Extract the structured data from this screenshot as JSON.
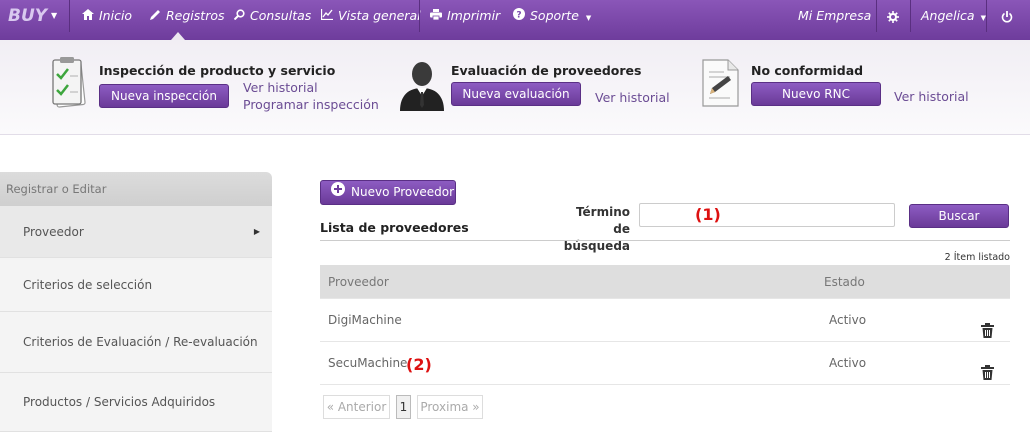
{
  "navbar": {
    "brand": "BUY",
    "items": [
      {
        "label": "Inicio"
      },
      {
        "label": "Registros"
      },
      {
        "label": "Consultas"
      },
      {
        "label": "Vista general"
      },
      {
        "label": "Imprimir"
      },
      {
        "label": "Soporte"
      }
    ],
    "company": "Mi Empresa",
    "user": "Angelica"
  },
  "modules": {
    "inspection": {
      "title": "Inspección de producto y servicio",
      "button": "Nueva inspección",
      "link_history": "Ver historial",
      "link_schedule": "Programar inspección"
    },
    "suppliers": {
      "title": "Evaluación de proveedores",
      "button": "Nueva evaluación",
      "link_history": "Ver historial"
    },
    "nonconformity": {
      "title": "No conformidad",
      "button": "Nuevo RNC",
      "link_history": "Ver historial"
    }
  },
  "sidebar": {
    "header": "Registrar o Editar",
    "items": [
      {
        "label": "Proveedor"
      },
      {
        "label": "Criterios de selección"
      },
      {
        "label": "Criterios de Evaluación / Re-evaluación"
      },
      {
        "label": "Productos / Servicios Adquiridos"
      }
    ]
  },
  "main": {
    "new_button": "Nuevo Proveedor",
    "list_title": "Lista de proveedores",
    "search_label": "Término de búsqueda",
    "search_value": "",
    "search_button": "Buscar",
    "count_text": "2 Ítem listado",
    "columns": [
      "Proveedor",
      "Estado"
    ],
    "rows": [
      {
        "name": "DigiMachine",
        "status": "Activo"
      },
      {
        "name": "SecuMachine",
        "status": "Activo"
      }
    ],
    "pager": {
      "prev": "« Anterior",
      "page": "1",
      "next": "Proxima »"
    }
  },
  "annotations": [
    "(1)",
    "(2)"
  ],
  "colors": {
    "accent": "#7a4aad",
    "link": "#6b4c94",
    "annotation": "#dd1111"
  }
}
